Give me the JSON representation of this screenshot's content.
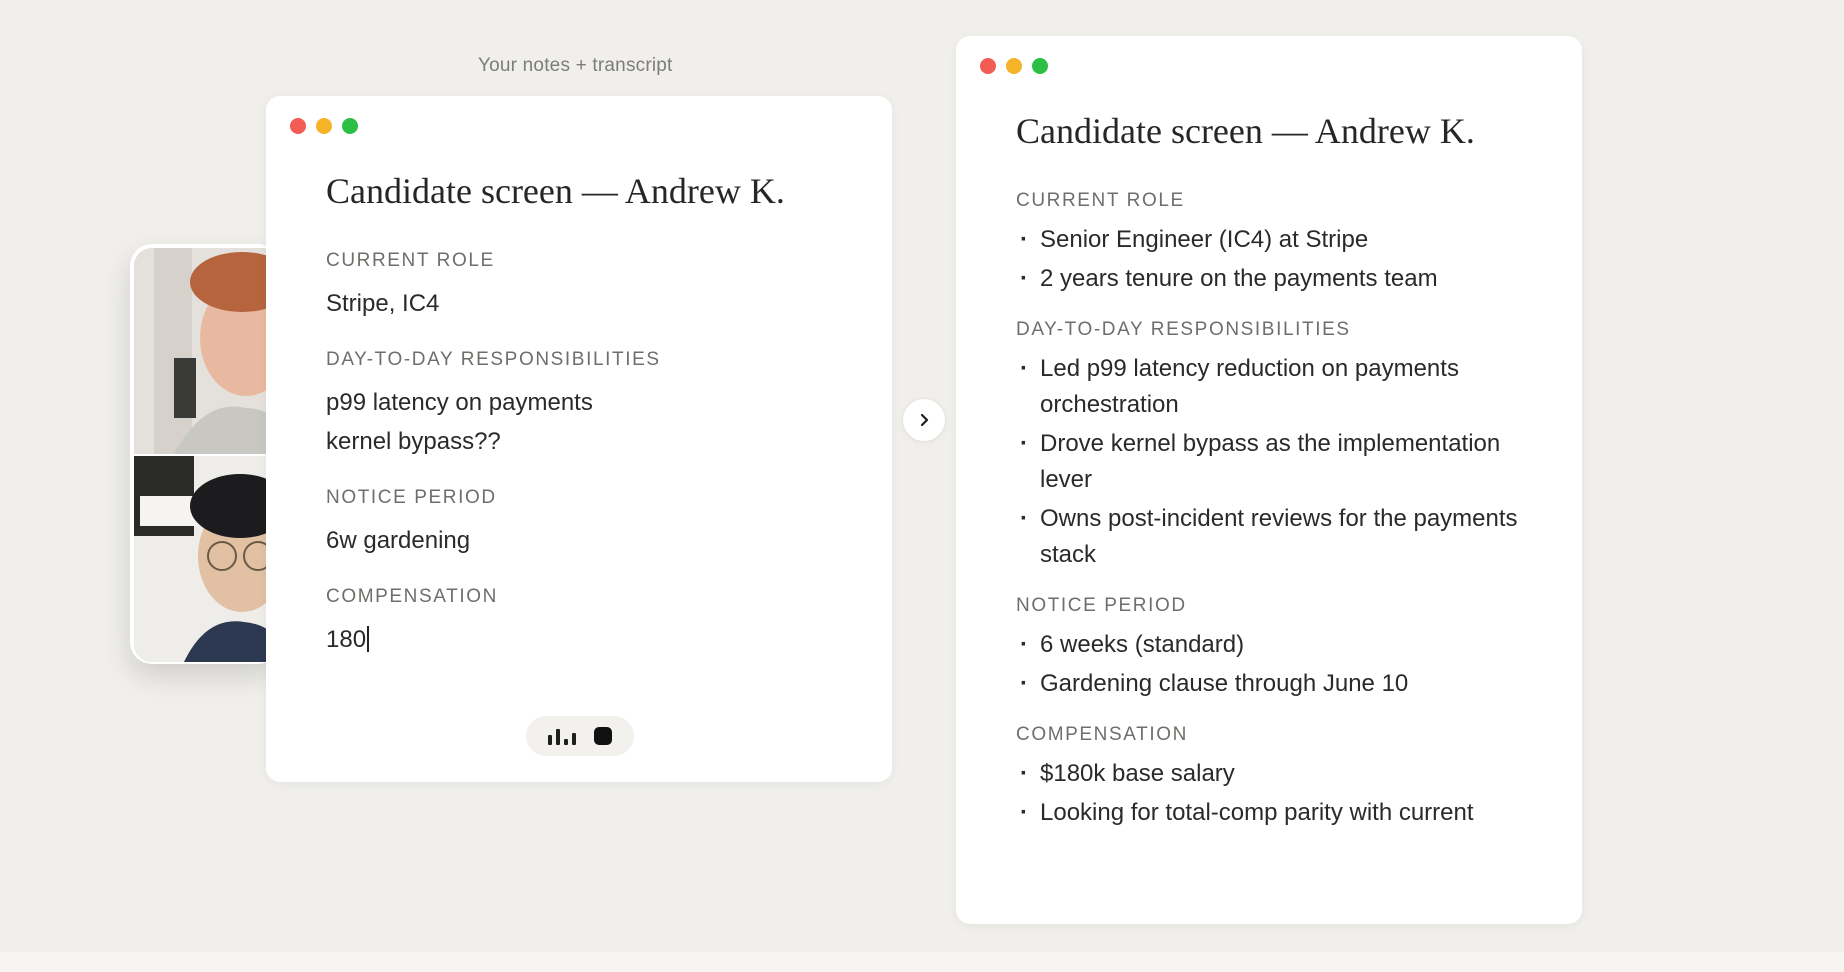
{
  "caption": "Your notes + transcript",
  "left_note": {
    "title": "Candidate screen — Andrew K.",
    "sections": [
      {
        "label": "CURRENT ROLE",
        "lines": [
          "Stripe, IC4"
        ]
      },
      {
        "label": "DAY-TO-DAY RESPONSIBILITIES",
        "lines": [
          "p99 latency on payments",
          "kernel bypass??"
        ]
      },
      {
        "label": "NOTICE PERIOD",
        "lines": [
          "6w gardening"
        ]
      },
      {
        "label": "COMPENSATION",
        "lines": [
          "180"
        ]
      }
    ]
  },
  "recorder": {
    "level_bars": [
      0.55,
      0.9,
      0.35,
      0.65
    ]
  },
  "enhanced_note": {
    "title": "Candidate screen — Andrew K.",
    "sections": [
      {
        "label": "CURRENT ROLE",
        "bullets": [
          "Senior Engineer (IC4) at Stripe",
          "2 years tenure on the payments team"
        ]
      },
      {
        "label": "DAY-TO-DAY RESPONSIBILITIES",
        "bullets": [
          "Led p99 latency reduction on payments orchestration",
          "Drove kernel bypass as the implementation lever",
          "Owns post-incident reviews for the payments stack"
        ]
      },
      {
        "label": "NOTICE PERIOD",
        "bullets": [
          "6 weeks (standard)",
          "Gardening clause through June 10"
        ]
      },
      {
        "label": "COMPENSATION",
        "bullets": [
          "$180k base salary",
          "Looking for total-comp parity with current"
        ]
      }
    ]
  },
  "colors": {
    "background": "#f0efeb",
    "window_red": "#f25c55",
    "window_yellow": "#f5b427",
    "window_green": "#2bbf45"
  },
  "icons": [
    "chevron-right-icon",
    "audio-level-icon",
    "stop-icon"
  ]
}
